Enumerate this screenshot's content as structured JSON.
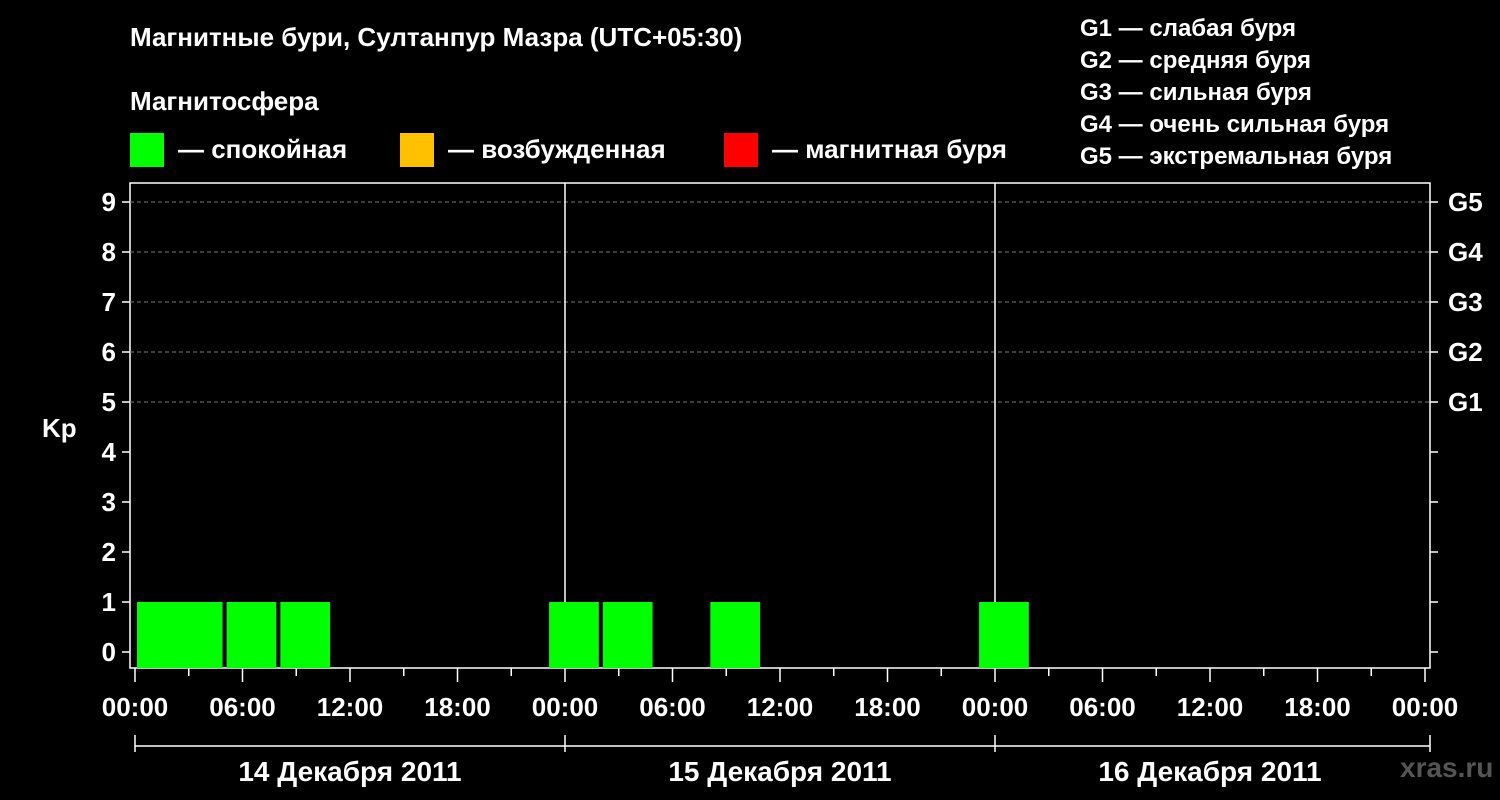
{
  "title": "Магнитные бури, Султанпур Мазра (UTC+05:30)",
  "magnetosphere_title": "Магнитосфера",
  "legend": [
    {
      "label": "— спокойная",
      "color": "#00ff00"
    },
    {
      "label": "— возбужденная",
      "color": "#ffc000"
    },
    {
      "label": "— магнитная буря",
      "color": "#ff0000"
    }
  ],
  "g_legend": [
    "G1 — слабая буря",
    "G2 — средняя буря",
    "G3 — сильная буря",
    "G4 — очень сильная буря",
    "G5 — экстремальная буря"
  ],
  "watermark": "xras.ru",
  "chart_data": {
    "type": "bar",
    "ylabel": "Kp",
    "ylim": [
      0,
      9
    ],
    "y_ticks": [
      "0",
      "1",
      "2",
      "3",
      "4",
      "5",
      "6",
      "7",
      "8",
      "9"
    ],
    "g_ticks": [
      {
        "kp": 5,
        "label": "G1"
      },
      {
        "kp": 6,
        "label": "G2"
      },
      {
        "kp": 7,
        "label": "G3"
      },
      {
        "kp": 8,
        "label": "G4"
      },
      {
        "kp": 9,
        "label": "G5"
      }
    ],
    "x_tick_labels": [
      "00:00",
      "06:00",
      "12:00",
      "18:00",
      "00:00",
      "06:00",
      "12:00",
      "18:00",
      "00:00",
      "06:00",
      "12:00",
      "18:00",
      "00:00"
    ],
    "days": [
      "14 Декабря 2011",
      "15 Декабря 2011",
      "16 Декабря 2011"
    ],
    "grid": "dashed at Kp 5–9",
    "bars": [
      {
        "day": 0,
        "start_hour": 0,
        "kp": 1,
        "level": "спокойная",
        "color": "#00ff00"
      },
      {
        "day": 0,
        "start_hour": 2,
        "kp": 1,
        "level": "спокойная",
        "color": "#00ff00"
      },
      {
        "day": 0,
        "start_hour": 5,
        "kp": 1,
        "level": "спокойная",
        "color": "#00ff00"
      },
      {
        "day": 0,
        "start_hour": 8,
        "kp": 1,
        "level": "спокойная",
        "color": "#00ff00"
      },
      {
        "day": 0,
        "start_hour": 23,
        "kp": 1,
        "level": "спокойная",
        "color": "#00ff00"
      },
      {
        "day": 1,
        "start_hour": 2,
        "kp": 1,
        "level": "спокойная",
        "color": "#00ff00"
      },
      {
        "day": 1,
        "start_hour": 8,
        "kp": 1,
        "level": "спокойная",
        "color": "#00ff00"
      },
      {
        "day": 1,
        "start_hour": 23,
        "kp": 1,
        "level": "спокойная",
        "color": "#00ff00"
      }
    ]
  }
}
